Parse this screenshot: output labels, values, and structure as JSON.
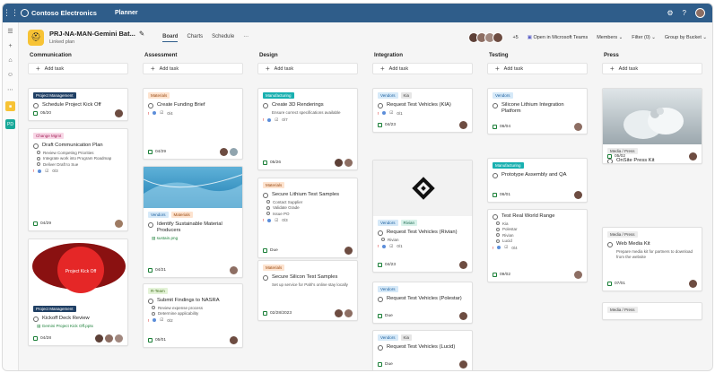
{
  "app": {
    "org": "Contoso Electronics",
    "name": "Planner"
  },
  "plan": {
    "title": "PRJ-NA-MAN-Gemini Bat...",
    "subtitle": "Linked plan"
  },
  "tabs": [
    "Board",
    "Charts",
    "Schedule",
    "···"
  ],
  "header": {
    "member_extra": "+5",
    "teams": "Open in Microsoft Teams",
    "members": "Members",
    "filter": "Filter (0)",
    "group": "Group by Bucket"
  },
  "add_task": "Add task",
  "columns": [
    {
      "title": "Communication",
      "cards": [
        {
          "tags": [
            {
              "t": "Project Management",
              "c": "#1f3f64",
              "f": "#fff"
            }
          ],
          "title": "Schedule Project Kick Off",
          "date": "05/20",
          "avs": [
            "#6d4c41"
          ]
        },
        {
          "tags": [
            {
              "t": "Change Mgmt",
              "c": "#f8d7e6",
              "f": "#a3245a"
            }
          ],
          "title": "Draft Communication Plan",
          "items": [
            "Review Competing Priorities",
            "Integrate work into Program Roadmap",
            "Deliver Draft to Sue"
          ],
          "progress": "0/3",
          "date": "04/29",
          "avs": [
            "#9e7b63"
          ]
        },
        {
          "image": "kickoff",
          "tags": [
            {
              "t": "Project Management",
              "c": "#1f3f64",
              "f": "#fff"
            }
          ],
          "title": "Kickoff Deck Review",
          "att": "Gemini Project Kick Off.pptx",
          "date": "04/28",
          "avs": [
            "#5d4037",
            "#8d6e63",
            "#a1887f"
          ]
        }
      ]
    },
    {
      "title": "Assessment",
      "cards": [
        {
          "tags": [
            {
              "t": "Materials",
              "c": "#fde3cf",
              "f": "#9a4a12"
            }
          ],
          "title": "Create Funding Brief",
          "progress": "0/4",
          "date": "04/29",
          "avs": [
            "#6d4c41",
            "#90a4ae"
          ]
        },
        {
          "image": "wave",
          "tags": [
            {
              "t": "Vendors",
              "c": "#d6e9f8",
              "f": "#1b5f9e"
            },
            {
              "t": "Materials",
              "c": "#fde3cf",
              "f": "#9a4a12"
            }
          ],
          "title": "Identify Sustainable Material Producers",
          "att": "sustain.png",
          "date": "04/21",
          "avs": [
            "#8d6e63"
          ]
        },
        {
          "tags": [
            {
              "t": "R-Team",
              "c": "#e4f3d8",
              "f": "#3f6e1b"
            }
          ],
          "title": "Submit Findings to NASRA",
          "items": [
            "Review expense process",
            "Determine applicability"
          ],
          "progress": "0/2",
          "date": "05/01",
          "avs": [
            "#6d4c41"
          ]
        }
      ]
    },
    {
      "title": "Design",
      "cards": [
        {
          "tags": [
            {
              "t": "Manufacturing",
              "c": "#18b0b0",
              "f": "#fff"
            }
          ],
          "title": "Create 3D Renderings",
          "note": "Ensure correct specifications available",
          "progress": "0/7",
          "date": "05/26",
          "avs": [
            "#5d4037",
            "#8d6e63"
          ]
        },
        {
          "tags": [
            {
              "t": "Materials",
              "c": "#fde3cf",
              "f": "#9a4a12"
            }
          ],
          "title": "Secure Lithium Test Samples",
          "items": [
            "Contact Supplier",
            "Validate Grade",
            "Issue PO"
          ],
          "progress": "0/3",
          "date": "Due",
          "avs": [
            "#6d4c41"
          ]
        },
        {
          "tags": [
            {
              "t": "Materials",
              "c": "#fde3cf",
              "f": "#9a4a12"
            }
          ],
          "title": "Secure Silicon Test Samples",
          "note": "Set up service for Pahl's online stay locally",
          "date": "02/28/2023",
          "avs": [
            "#6d4c41",
            "#8d6e63"
          ]
        }
      ]
    },
    {
      "title": "Integration",
      "cards": [
        {
          "tags": [
            {
              "t": "Vendors",
              "c": "#d6e9f8",
              "f": "#1b5f9e"
            },
            {
              "t": "Kia",
              "c": "#e6e6e6",
              "f": "#444"
            }
          ],
          "title": "Request Test Vehicles (KIA)",
          "progress": "0/1",
          "date": "04/23",
          "avs": [
            "#6d4c41"
          ]
        },
        {
          "image": "logo",
          "tags": [
            {
              "t": "Vendors",
              "c": "#d6e9f8",
              "f": "#1b5f9e"
            },
            {
              "t": "Rivian",
              "c": "#d9f2ea",
              "f": "#1e6b53"
            }
          ],
          "title": "Request Test Vehicles (Rivian)",
          "items": [
            "Rivian"
          ],
          "progress": "0/1",
          "date": "04/23",
          "avs": [
            "#6d4c41"
          ]
        },
        {
          "tags": [
            {
              "t": "Vendors",
              "c": "#d6e9f8",
              "f": "#1b5f9e"
            }
          ],
          "title": "Request Test Vehicles (Polestar)",
          "date": "Due",
          "avs": [
            "#6d4c41"
          ]
        },
        {
          "tags": [
            {
              "t": "Vendors",
              "c": "#d6e9f8",
              "f": "#1b5f9e"
            },
            {
              "t": "Kia",
              "c": "#e6e6e6",
              "f": "#444"
            }
          ],
          "title": "Request Test Vehicles (Lucid)",
          "date": "Due",
          "avs": [
            "#6d4c41"
          ]
        }
      ]
    },
    {
      "title": "Testing",
      "cards": [
        {
          "tags": [
            {
              "t": "Vendors",
              "c": "#d6e9f8",
              "f": "#1b5f9e"
            }
          ],
          "title": "Silicone Lithium Integration Platform",
          "date": "06/04",
          "avs": [
            "#8d6e63"
          ]
        },
        {
          "tags": [
            {
              "t": "Manufacturing",
              "c": "#18b0b0",
              "f": "#fff"
            }
          ],
          "title": "Prototype Assembly and QA",
          "date": "06/01",
          "avs": [
            "#6d4c41"
          ]
        },
        {
          "title": "Test Real World Range",
          "items": [
            "Kia",
            "Polestar",
            "Rivian",
            "Lucid"
          ],
          "progress": "0/4",
          "date": "09/02",
          "avs": [
            "#8d6e63"
          ]
        }
      ]
    },
    {
      "title": "Press",
      "cards": [
        {
          "image": "hands",
          "tags": [
            {
              "t": "Media / Press",
              "c": "#ececec",
              "f": "#444"
            }
          ],
          "title": "OnSite Press Kit",
          "att": "pexels-thirdwaveagreeing-3861427.jpg",
          "date": "05/02",
          "avs": [
            "#6d4c41"
          ]
        },
        {
          "tags": [
            {
              "t": "Media / Press",
              "c": "#ececec",
              "f": "#444"
            }
          ],
          "title": "Web Media Kit",
          "note": "Prepare media kit for partners to download from the website",
          "date": "07/01",
          "avs": [
            "#6d4c41"
          ]
        },
        {
          "tags": [
            {
              "t": "Media / Press",
              "c": "#ececec",
              "f": "#444"
            }
          ]
        }
      ]
    }
  ]
}
